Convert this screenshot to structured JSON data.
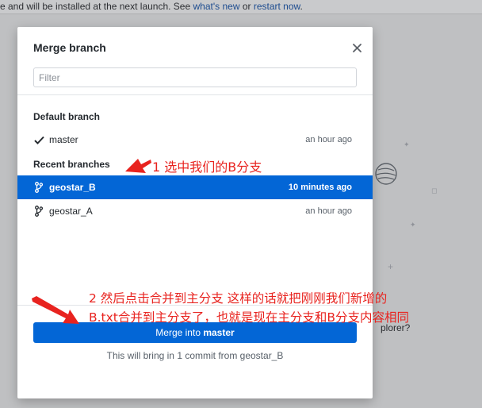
{
  "background": {
    "banner_prefix": "e and will be installed at the next launch. See ",
    "banner_link_1": "what's new",
    "banner_mid": " or ",
    "banner_link_2": "restart now",
    "banner_suffix": ".",
    "hint_text": "plorer?"
  },
  "dialog": {
    "title": "Merge branch",
    "close_icon": "close-icon",
    "filter": {
      "placeholder": "Filter",
      "value": ""
    },
    "default_section": "Default branch",
    "default_branches": [
      {
        "name": "master",
        "time": "an hour ago",
        "icon": "checkmark-icon"
      }
    ],
    "recent_section": "Recent branches",
    "recent_branches": [
      {
        "name": "geostar_B",
        "time": "10 minutes ago",
        "icon": "branch-icon",
        "selected": true
      },
      {
        "name": "geostar_A",
        "time": "an hour ago",
        "icon": "branch-icon",
        "selected": false
      }
    ],
    "merge_button": {
      "prefix": "Merge into ",
      "target": "master"
    },
    "summary": "This will bring in 1 commit from geostar_B"
  },
  "annotations": {
    "step1": "1 选中我们的B分支",
    "step2_line1": "2 然后点击合并到主分支  这样的话就把刚刚我们新增的",
    "step2_line2": "B.txt合并到主分支了，也就是现在主分支和B分支内容相同",
    "color": "#e8231f"
  },
  "colors": {
    "accent": "#0366d6",
    "annotation": "#e8231f"
  }
}
